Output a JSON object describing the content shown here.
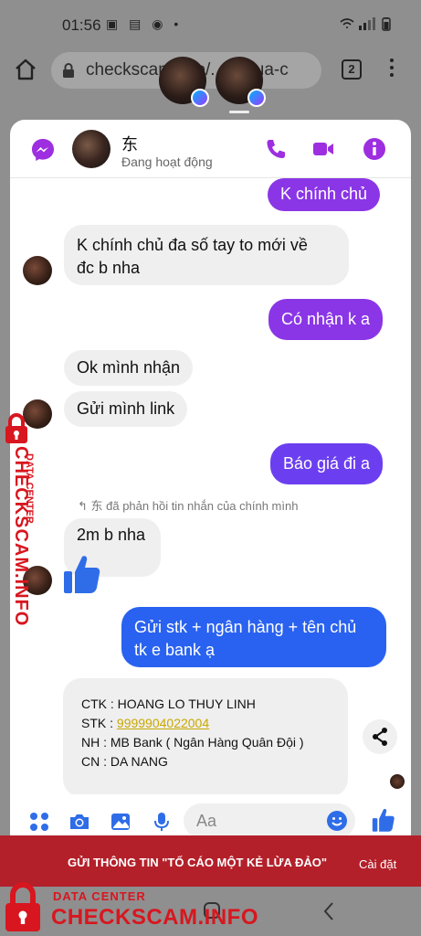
{
  "status_bar": {
    "time": "01:56",
    "dot": "•"
  },
  "browser": {
    "url": "checkscam.info/... -o-lua-c",
    "url_visible": "checkscam",
    "url_tail": "o-lua-c",
    "tab_count": "2"
  },
  "header": {
    "name": "东",
    "status": "Đang hoạt động"
  },
  "messages": [
    {
      "side": "out",
      "text": "K chính chủ"
    },
    {
      "side": "in",
      "text_1": "K chính chủ đa số tay to mới về",
      "text_2": "đc b nha"
    },
    {
      "side": "out",
      "text": "Có nhận k a"
    },
    {
      "side": "in",
      "text": "Ok mình nhận"
    },
    {
      "side": "in",
      "text": "Gửi mình link"
    },
    {
      "side": "out",
      "text": "Báo giá đi a"
    },
    {
      "side": "in",
      "text": "2m b nha"
    },
    {
      "side": "out",
      "text_1": "Gửi stk + ngân hàng + tên chủ",
      "text_2": "tk e bank ạ"
    }
  ],
  "reply_note": "东 đã phản hồi tin nhắn của chính mình",
  "bank_card": {
    "ctk": "CTK : HOANG LO THUY LINH",
    "stk_label": "STK : ",
    "stk_number": "9999904022004",
    "nh": "NH : MB Bank ( Ngân Hàng Quân Đội )",
    "cn": "CN : DA NANG"
  },
  "composer": {
    "placeholder": "Aa"
  },
  "banner": {
    "text": "GỬI THÔNG TIN \"TỐ CÁO MỘT KẺ LỪA ĐẢO\"",
    "settings": "Cài đặt"
  },
  "watermark": {
    "main": "CHECKSCAM.INFO",
    "sub": "DATA CENTER"
  },
  "colors": {
    "messenger_purple": "#8a36e6",
    "messenger_blue": "#2962f0",
    "watermark_red": "#d8161f",
    "banner_red": "#b3202a"
  }
}
